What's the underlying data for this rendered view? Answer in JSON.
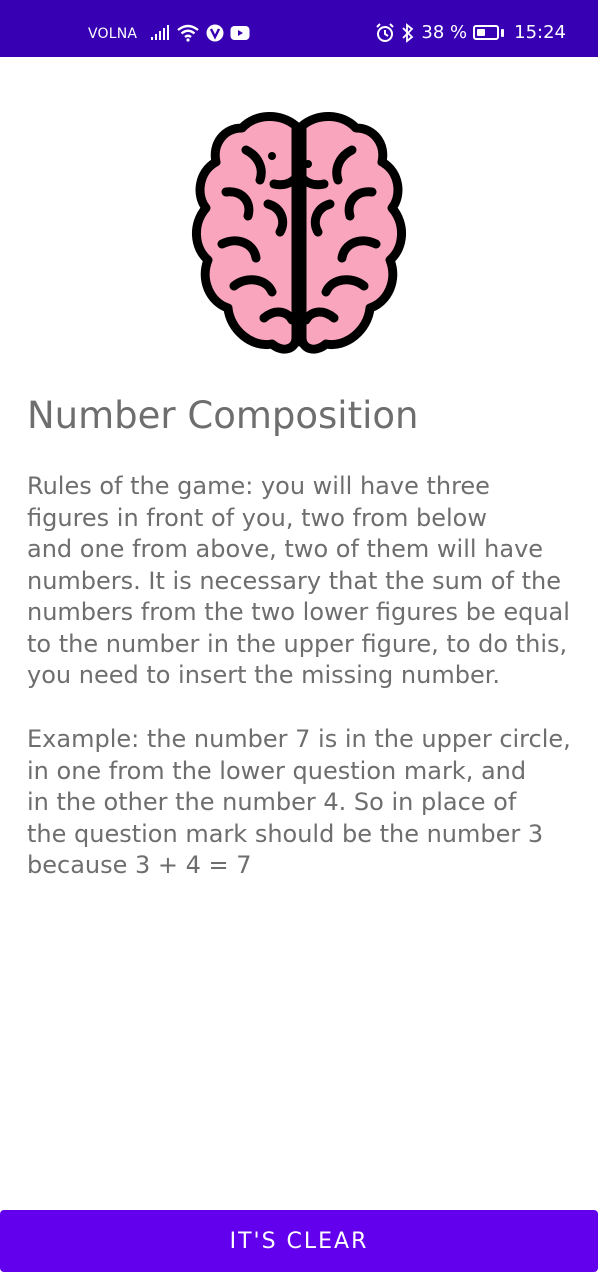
{
  "status_bar": {
    "carrier": "VOLNA",
    "battery_percent": "38 %",
    "time": "15:24",
    "icons_left": [
      "signal-icon",
      "wifi-icon",
      "v-app-icon",
      "youtube-icon"
    ],
    "icons_right": [
      "alarm-icon",
      "bluetooth-icon",
      "battery-icon"
    ],
    "background": "#3700b3"
  },
  "main": {
    "image_icon": "brain-icon",
    "title": "Number Composition",
    "rules": "Rules of the game: you will have three\nfigures in front of you, two from below\nand one from above, two of them will have\nnumbers. It is necessary that the sum of the\nnumbers from the two lower figures be equal\nto the number in the upper figure, to do this,\nyou need to insert the missing number.",
    "example": "Example: the number 7 is in the upper circle,\nin one from the lower question mark, and\nin the other the number 4. So in place of\nthe question mark should be the number 3\nbecause 3 + 4 = 7"
  },
  "footer": {
    "button_label": "IT'S CLEAR",
    "button_color": "#6200ee"
  },
  "colors": {
    "brain_fill": "#f8a5bd",
    "text": "#6e6e6e"
  }
}
